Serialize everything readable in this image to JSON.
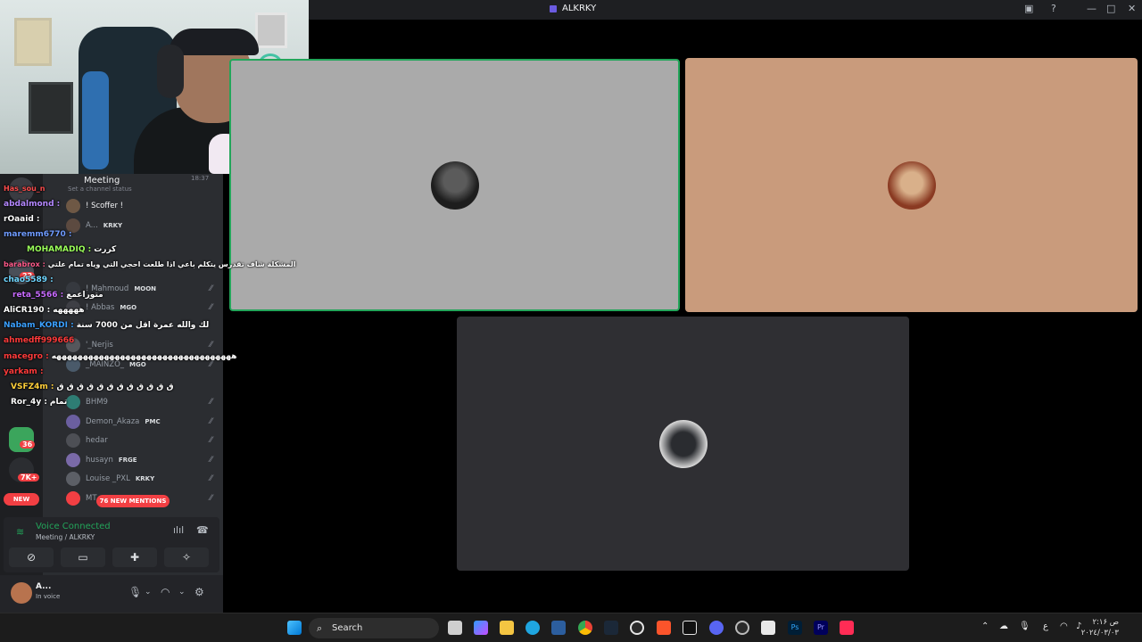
{
  "window": {
    "title": "ALKRKY"
  },
  "channel": {
    "name": "Meeting",
    "status": "Set a channel status",
    "time": "18:37"
  },
  "members": [
    {
      "name": "! Scoffer !",
      "tag": ""
    },
    {
      "name": "A...",
      "tag": "KRKY"
    },
    {
      "name": "! Mahmoud",
      "tag": "MOON"
    },
    {
      "name": "! Abbas",
      "tag": "MGO"
    },
    {
      "name": "'_Nerjis",
      "tag": ""
    },
    {
      "name": "_MAINZO_",
      "tag": "MGO"
    },
    {
      "name": "BHM9",
      "tag": ""
    },
    {
      "name": "Demon_Akaza",
      "tag": "PMC"
    },
    {
      "name": "hedar",
      "tag": ""
    },
    {
      "name": "husayn",
      "tag": "FRGE"
    },
    {
      "name": "Louise _PXL",
      "tag": "KRKY"
    },
    {
      "name": "MT",
      "tag": ""
    }
  ],
  "mentions_pill": "76 NEW MENTIONS",
  "new_pill": "NEW",
  "badges": [
    "22",
    "36",
    "7K+"
  ],
  "voice": {
    "title": "Voice Connected",
    "sub": "Meeting / ALKRKY"
  },
  "user": {
    "name": "A...",
    "status": "In voice"
  },
  "chat": [
    {
      "nick": "Has_sou_n",
      "color": "#ff4d4d",
      "msg": ""
    },
    {
      "nick": "abdalmond :",
      "color": "#b488ff",
      "msg": ""
    },
    {
      "nick": "rOaaid :",
      "color": "#ffffff",
      "msg": ""
    },
    {
      "nick": "maremm6770 :",
      "color": "#6f9bff",
      "msg": ""
    },
    {
      "nick": "MOHAMADIQ :",
      "color": "#9bff5a",
      "msg": "كررت"
    },
    {
      "nick": "barabrox :",
      "color": "#ff5a8a",
      "msg": "المشكلة شاف تقدرس يتكلم باعي اذا طلعت احجي التي وياه تمام علتي"
    },
    {
      "nick": "chao5589 :",
      "color": "#6fd6ff",
      "msg": ""
    },
    {
      "nick": "reta_5566 :",
      "color": "#c86bff",
      "msg": "متوراعمع"
    },
    {
      "nick": "AliCR190 :",
      "color": "#ffffff",
      "msg": "هههههه"
    },
    {
      "nick": "Nabam_KORDI :",
      "color": "#3aa0ff",
      "msg": "لك والله عمرة اقل من 7000 سنة"
    },
    {
      "nick": "ahmedff999666",
      "color": "#ff3b3b",
      "msg": ""
    },
    {
      "nick": "macegro :",
      "color": "#ff3b3b",
      "msg": "ههههههههههههههههههههههههههههههههههه"
    },
    {
      "nick": "yarkam :",
      "color": "#ff3b3b",
      "msg": ""
    },
    {
      "nick": "VSFZ4m :",
      "color": "#ffcf3a",
      "msg": "ق ق ق ق ق ق ق ق ق ق ق ق"
    },
    {
      "nick": "Ror_4y :",
      "color": "#ffffff",
      "msg": "تمام"
    }
  ],
  "taskbar": {
    "search_placeholder": "Search",
    "clock_time": "۲:۱۶ ص",
    "clock_date": "۲۰۲٤/۰۳/۰۳",
    "lang": "ع"
  },
  "colors": {
    "speaking": "#23a55a",
    "tile2": "#c99b7c",
    "tile3": "#2f2f33",
    "accent": "#5865f2"
  }
}
